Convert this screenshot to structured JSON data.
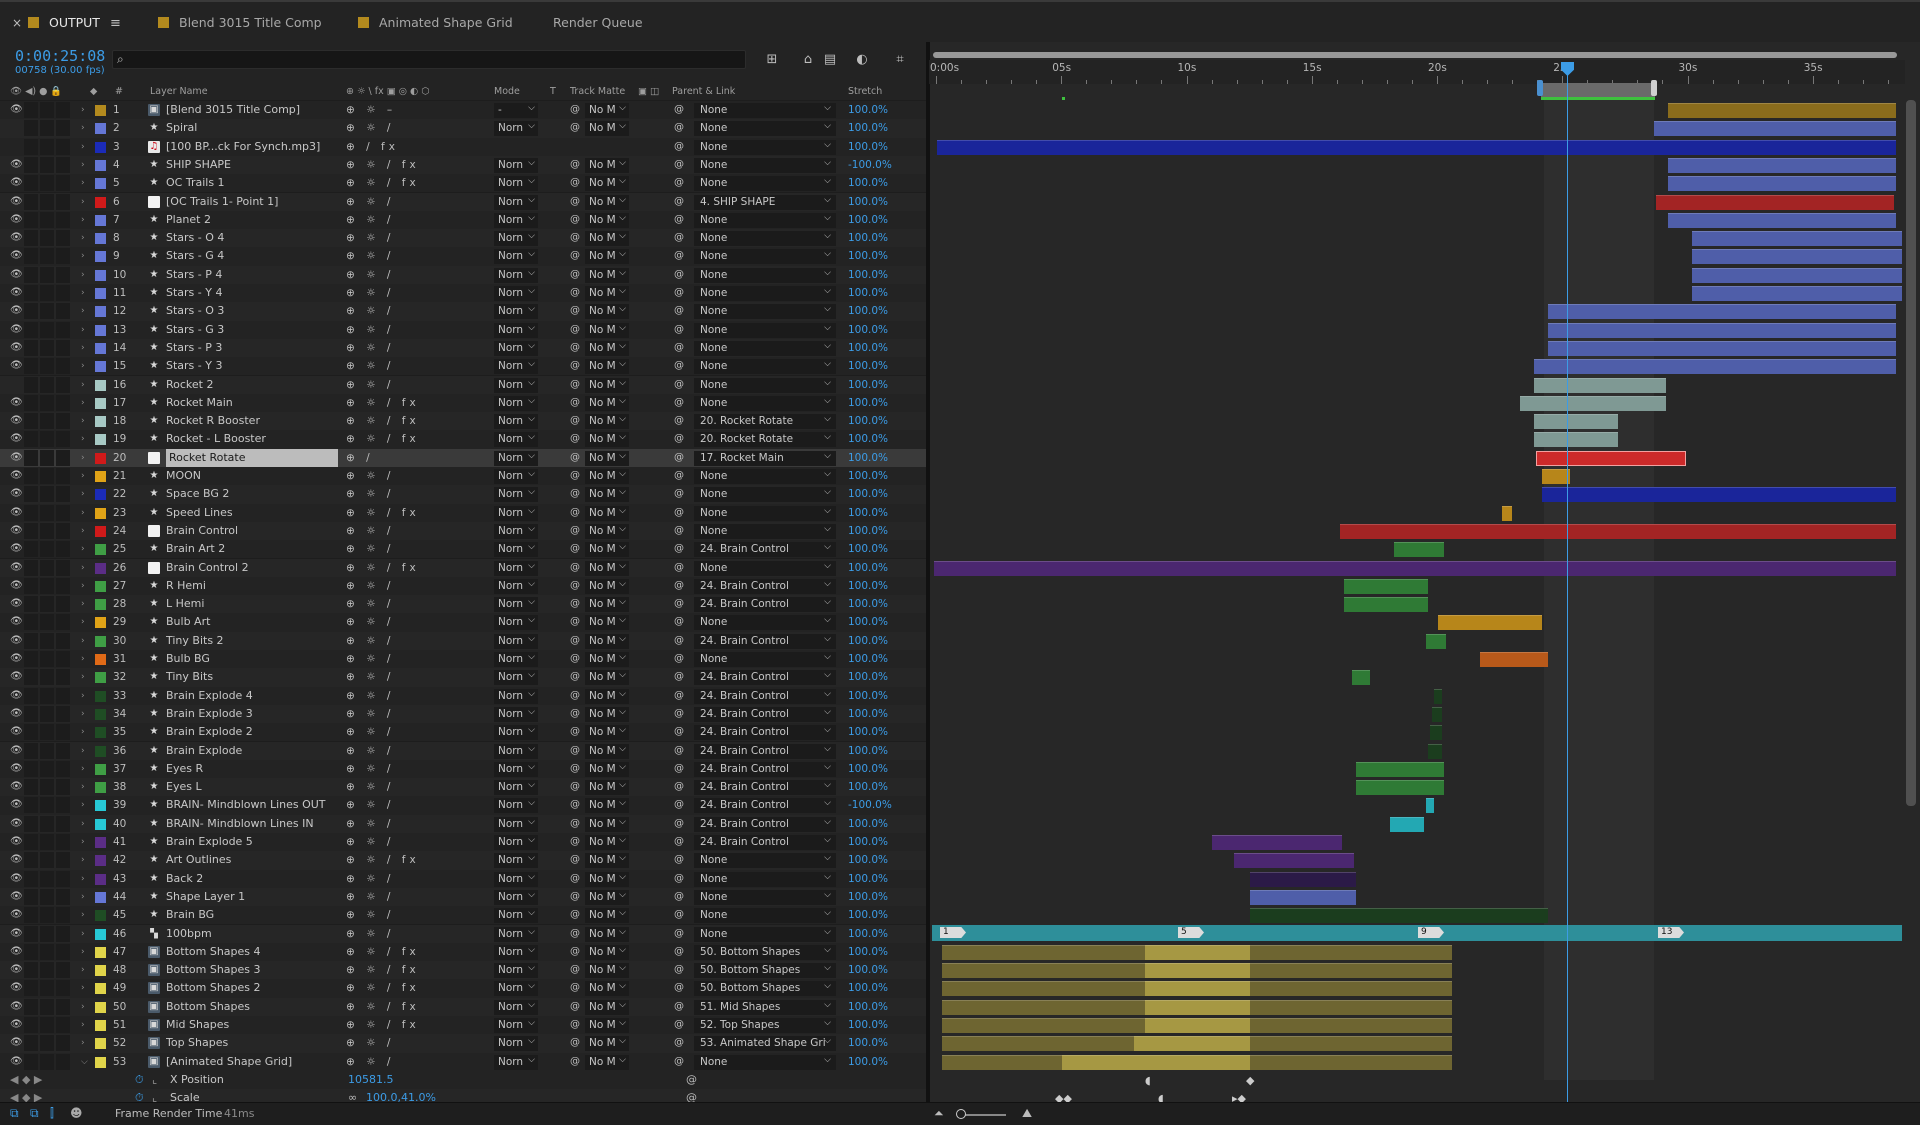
{
  "tabs": [
    {
      "label": "OUTPUT",
      "color": "#b38a1e",
      "active": true
    },
    {
      "label": "Blend 3015 Title Comp",
      "color": "#b38a1e"
    },
    {
      "label": "Animated Shape Grid",
      "color": "#b38a1e"
    },
    {
      "label": "Render Queue"
    }
  ],
  "header": {
    "timecode": "0:00:25:08",
    "frames": "00758 (30.00 fps)",
    "search_placeholder": ""
  },
  "columns": {
    "layer_name": "Layer Name",
    "mode": "Mode",
    "t": "T",
    "track_matte": "Track Matte",
    "parent": "Parent & Link",
    "stretch": "Stretch",
    "num": "#"
  },
  "ruler": {
    "labels": [
      "0:00s",
      "05s",
      "10s",
      "15s",
      "20s",
      "25s",
      "30s",
      "35s"
    ]
  },
  "layers": [
    {
      "n": "1",
      "name": "[Blend 3015 Title Comp]",
      "color": "#b38a1e",
      "icon": "comp",
      "sw": "⊕ ☼ –",
      "mode": "-",
      "matte": "No M",
      "parent": "None",
      "stretch": "100.0%",
      "eye": true
    },
    {
      "n": "2",
      "name": "Spiral",
      "color": "#6577d6",
      "icon": "shape",
      "sw": "⊕ ☼ /",
      "mode": "Norn",
      "matte": "No M",
      "parent": "None",
      "stretch": "100.0%",
      "eye": false
    },
    {
      "n": "3",
      "name": "[100 BP...ck For Synch.mp3]",
      "color": "#1b2bb8",
      "icon": "audio",
      "sw": "⊕   / fx",
      "mode": "",
      "matte": "",
      "parent": "None",
      "stretch": "100.0%",
      "eye": false
    },
    {
      "n": "4",
      "name": "SHIP SHAPE",
      "color": "#6577d6",
      "icon": "shape",
      "sw": "⊕ ☼ / fx",
      "mode": "Norn",
      "matte": "No M",
      "parent": "None",
      "stretch": "-100.0%",
      "eye": true
    },
    {
      "n": "5",
      "name": "OC Trails 1",
      "color": "#6577d6",
      "icon": "shape",
      "sw": "⊕ ☼ / fx",
      "mode": "Norn",
      "matte": "No M",
      "parent": "None",
      "stretch": "100.0%",
      "eye": true
    },
    {
      "n": "6",
      "name": "[OC Trails 1- Point 1]",
      "color": "#d01a1a",
      "icon": "null",
      "sw": "⊕ ☼ /",
      "mode": "Norn",
      "matte": "No M",
      "parent": "4. SHIP SHAPE",
      "stretch": "100.0%",
      "eye": true
    },
    {
      "n": "7",
      "name": "Planet 2",
      "color": "#6577d6",
      "icon": "shape",
      "sw": "⊕ ☼ /",
      "mode": "Norn",
      "matte": "No M",
      "parent": "None",
      "stretch": "100.0%",
      "eye": true
    },
    {
      "n": "8",
      "name": "Stars - O 4",
      "color": "#6577d6",
      "icon": "shape",
      "sw": "⊕ ☼ /",
      "mode": "Norn",
      "matte": "No M",
      "parent": "None",
      "stretch": "100.0%",
      "eye": true
    },
    {
      "n": "9",
      "name": "Stars - G 4",
      "color": "#6577d6",
      "icon": "shape",
      "sw": "⊕ ☼ /",
      "mode": "Norn",
      "matte": "No M",
      "parent": "None",
      "stretch": "100.0%",
      "eye": true
    },
    {
      "n": "10",
      "name": "Stars - P 4",
      "color": "#6577d6",
      "icon": "shape",
      "sw": "⊕ ☼ /",
      "mode": "Norn",
      "matte": "No M",
      "parent": "None",
      "stretch": "100.0%",
      "eye": true
    },
    {
      "n": "11",
      "name": "Stars - Y 4",
      "color": "#6577d6",
      "icon": "shape",
      "sw": "⊕ ☼ /",
      "mode": "Norn",
      "matte": "No M",
      "parent": "None",
      "stretch": "100.0%",
      "eye": true
    },
    {
      "n": "12",
      "name": "Stars - O 3",
      "color": "#6577d6",
      "icon": "shape",
      "sw": "⊕ ☼ /",
      "mode": "Norn",
      "matte": "No M",
      "parent": "None",
      "stretch": "100.0%",
      "eye": true
    },
    {
      "n": "13",
      "name": "Stars - G 3",
      "color": "#6577d6",
      "icon": "shape",
      "sw": "⊕ ☼ /",
      "mode": "Norn",
      "matte": "No M",
      "parent": "None",
      "stretch": "100.0%",
      "eye": true
    },
    {
      "n": "14",
      "name": "Stars - P 3",
      "color": "#6577d6",
      "icon": "shape",
      "sw": "⊕ ☼ /",
      "mode": "Norn",
      "matte": "No M",
      "parent": "None",
      "stretch": "100.0%",
      "eye": true
    },
    {
      "n": "15",
      "name": "Stars - Y 3",
      "color": "#6577d6",
      "icon": "shape",
      "sw": "⊕ ☼ /",
      "mode": "Norn",
      "matte": "No M",
      "parent": "None",
      "stretch": "100.0%",
      "eye": true
    },
    {
      "n": "16",
      "name": "Rocket 2",
      "color": "#a7c9c4",
      "icon": "shape",
      "sw": "⊕ ☼ /",
      "mode": "Norn",
      "matte": "No M",
      "parent": "None",
      "stretch": "100.0%",
      "eye": false
    },
    {
      "n": "17",
      "name": "Rocket Main",
      "color": "#a7c9c4",
      "icon": "shape",
      "sw": "⊕ ☼ / fx",
      "mode": "Norn",
      "matte": "No M",
      "parent": "None",
      "stretch": "100.0%",
      "eye": true
    },
    {
      "n": "18",
      "name": "Rocket R Booster",
      "color": "#a7c9c4",
      "icon": "shape",
      "sw": "⊕ ☼ / fx",
      "mode": "Norn",
      "matte": "No M",
      "parent": "20. Rocket Rotate",
      "stretch": "100.0%",
      "eye": true
    },
    {
      "n": "19",
      "name": "Rocket - L Booster",
      "color": "#a7c9c4",
      "icon": "shape",
      "sw": "⊕ ☼ / fx",
      "mode": "Norn",
      "matte": "No M",
      "parent": "20. Rocket Rotate",
      "stretch": "100.0%",
      "eye": true
    },
    {
      "n": "20",
      "name": "Rocket Rotate",
      "color": "#d01a1a",
      "icon": "null",
      "sw": "⊕   /",
      "mode": "Norn",
      "matte": "No M",
      "parent": "17. Rocket Main",
      "stretch": "100.0%",
      "eye": true,
      "sel": true
    },
    {
      "n": "21",
      "name": "MOON",
      "color": "#e0a317",
      "icon": "shape",
      "sw": "⊕ ☼ /",
      "mode": "Norn",
      "matte": "No M",
      "parent": "None",
      "stretch": "100.0%",
      "eye": true
    },
    {
      "n": "22",
      "name": "Space BG 2",
      "color": "#1b2bb8",
      "icon": "shape",
      "sw": "⊕ ☼ /",
      "mode": "Norn",
      "matte": "No M",
      "parent": "None",
      "stretch": "100.0%",
      "eye": true
    },
    {
      "n": "23",
      "name": "Speed Lines",
      "color": "#e0a317",
      "icon": "shape",
      "sw": "⊕ ☼ / fx",
      "mode": "Norn",
      "matte": "No M",
      "parent": "None",
      "stretch": "100.0%",
      "eye": true
    },
    {
      "n": "24",
      "name": "Brain Control",
      "color": "#d01a1a",
      "icon": "null",
      "sw": "⊕ ☼ /",
      "mode": "Norn",
      "matte": "No M",
      "parent": "None",
      "stretch": "100.0%",
      "eye": true
    },
    {
      "n": "25",
      "name": "Brain Art 2",
      "color": "#3f9e45",
      "icon": "shape",
      "sw": "⊕ ☼ /",
      "mode": "Norn",
      "matte": "No M",
      "parent": "24. Brain Control",
      "stretch": "100.0%",
      "eye": true
    },
    {
      "n": "26",
      "name": "Brain Control 2",
      "color": "#5b2d86",
      "icon": "null",
      "sw": "⊕ ☼ / fx",
      "mode": "Norn",
      "matte": "No M",
      "parent": "None",
      "stretch": "100.0%",
      "eye": true
    },
    {
      "n": "27",
      "name": "R Hemi",
      "color": "#3f9e45",
      "icon": "shape",
      "sw": "⊕ ☼ /",
      "mode": "Norn",
      "matte": "No M",
      "parent": "24. Brain Control",
      "stretch": "100.0%",
      "eye": true
    },
    {
      "n": "28",
      "name": "L Hemi",
      "color": "#3f9e45",
      "icon": "shape",
      "sw": "⊕ ☼ /",
      "mode": "Norn",
      "matte": "No M",
      "parent": "24. Brain Control",
      "stretch": "100.0%",
      "eye": true
    },
    {
      "n": "29",
      "name": "Bulb Art",
      "color": "#e0a317",
      "icon": "shape",
      "sw": "⊕ ☼ /",
      "mode": "Norn",
      "matte": "No M",
      "parent": "None",
      "stretch": "100.0%",
      "eye": true
    },
    {
      "n": "30",
      "name": "Tiny Bits 2",
      "color": "#3f9e45",
      "icon": "shape",
      "sw": "⊕ ☼ /",
      "mode": "Norn",
      "matte": "No M",
      "parent": "24. Brain Control",
      "stretch": "100.0%",
      "eye": true
    },
    {
      "n": "31",
      "name": "Bulb BG",
      "color": "#e06a17",
      "icon": "shape",
      "sw": "⊕ ☼ /",
      "mode": "Norn",
      "matte": "No M",
      "parent": "None",
      "stretch": "100.0%",
      "eye": true
    },
    {
      "n": "32",
      "name": "Tiny Bits",
      "color": "#3f9e45",
      "icon": "shape",
      "sw": "⊕ ☼ /",
      "mode": "Norn",
      "matte": "No M",
      "parent": "24. Brain Control",
      "stretch": "100.0%",
      "eye": true
    },
    {
      "n": "33",
      "name": "Brain Explode 4",
      "color": "#1f4d24",
      "icon": "shape",
      "sw": "⊕ ☼ /",
      "mode": "Norn",
      "matte": "No M",
      "parent": "24. Brain Control",
      "stretch": "100.0%",
      "eye": true
    },
    {
      "n": "34",
      "name": "Brain Explode 3",
      "color": "#1f4d24",
      "icon": "shape",
      "sw": "⊕ ☼ /",
      "mode": "Norn",
      "matte": "No M",
      "parent": "24. Brain Control",
      "stretch": "100.0%",
      "eye": true
    },
    {
      "n": "35",
      "name": "Brain Explode 2",
      "color": "#1f4d24",
      "icon": "shape",
      "sw": "⊕ ☼ /",
      "mode": "Norn",
      "matte": "No M",
      "parent": "24. Brain Control",
      "stretch": "100.0%",
      "eye": true
    },
    {
      "n": "36",
      "name": "Brain Explode",
      "color": "#1f4d24",
      "icon": "shape",
      "sw": "⊕ ☼ /",
      "mode": "Norn",
      "matte": "No M",
      "parent": "24. Brain Control",
      "stretch": "100.0%",
      "eye": true
    },
    {
      "n": "37",
      "name": "Eyes R",
      "color": "#3f9e45",
      "icon": "shape",
      "sw": "⊕ ☼ /",
      "mode": "Norn",
      "matte": "No M",
      "parent": "24. Brain Control",
      "stretch": "100.0%",
      "eye": true
    },
    {
      "n": "38",
      "name": "Eyes L",
      "color": "#3f9e45",
      "icon": "shape",
      "sw": "⊕ ☼ /",
      "mode": "Norn",
      "matte": "No M",
      "parent": "24. Brain Control",
      "stretch": "100.0%",
      "eye": true
    },
    {
      "n": "39",
      "name": "BRAIN- Mindblown Lines OUT",
      "color": "#27c9d6",
      "icon": "shape",
      "sw": "⊕ ☼ /",
      "mode": "Norn",
      "matte": "No M",
      "parent": "24. Brain Control",
      "stretch": "-100.0%",
      "eye": true
    },
    {
      "n": "40",
      "name": "BRAIN- Mindblown Lines IN",
      "color": "#27c9d6",
      "icon": "shape",
      "sw": "⊕ ☼ /",
      "mode": "Norn",
      "matte": "No M",
      "parent": "24. Brain Control",
      "stretch": "100.0%",
      "eye": true
    },
    {
      "n": "41",
      "name": "Brain Explode 5",
      "color": "#5b2d86",
      "icon": "shape",
      "sw": "⊕ ☼ /",
      "mode": "Norn",
      "matte": "No M",
      "parent": "24. Brain Control",
      "stretch": "100.0%",
      "eye": true
    },
    {
      "n": "42",
      "name": "Art Outlines",
      "color": "#5b2d86",
      "icon": "shape",
      "sw": "⊕ ☼ / fx",
      "mode": "Norn",
      "matte": "No M",
      "parent": "None",
      "stretch": "100.0%",
      "eye": true
    },
    {
      "n": "43",
      "name": "Back 2",
      "color": "#5b2d86",
      "icon": "shape",
      "sw": "⊕ ☼ /",
      "mode": "Norn",
      "matte": "No M",
      "parent": "None",
      "stretch": "100.0%",
      "eye": true
    },
    {
      "n": "44",
      "name": "Shape Layer 1",
      "color": "#6577d6",
      "icon": "shape",
      "sw": "⊕ ☼ /",
      "mode": "Norn",
      "matte": "No M",
      "parent": "None",
      "stretch": "100.0%",
      "eye": true
    },
    {
      "n": "45",
      "name": "Brain BG",
      "color": "#1f4d24",
      "icon": "shape",
      "sw": "⊕ ☼ /",
      "mode": "Norn",
      "matte": "No M",
      "parent": "None",
      "stretch": "100.0%",
      "eye": true
    },
    {
      "n": "46",
      "name": "100bpm",
      "color": "#27c9d6",
      "icon": "marker",
      "sw": "⊕ ☼ /",
      "mode": "Norn",
      "matte": "No M",
      "parent": "None",
      "stretch": "100.0%",
      "eye": true
    },
    {
      "n": "47",
      "name": "Bottom Shapes 4",
      "color": "#e0d44a",
      "icon": "comp",
      "sw": "⊕ ☼ / fx",
      "mode": "Norn",
      "matte": "No M",
      "parent": "50. Bottom Shapes",
      "stretch": "100.0%",
      "eye": true
    },
    {
      "n": "48",
      "name": "Bottom Shapes 3",
      "color": "#e0d44a",
      "icon": "comp",
      "sw": "⊕ ☼ / fx",
      "mode": "Norn",
      "matte": "No M",
      "parent": "50. Bottom Shapes",
      "stretch": "100.0%",
      "eye": true
    },
    {
      "n": "49",
      "name": "Bottom Shapes 2",
      "color": "#e0d44a",
      "icon": "comp",
      "sw": "⊕ ☼ / fx",
      "mode": "Norn",
      "matte": "No M",
      "parent": "50. Bottom Shapes",
      "stretch": "100.0%",
      "eye": true
    },
    {
      "n": "50",
      "name": "Bottom Shapes",
      "color": "#e0d44a",
      "icon": "comp",
      "sw": "⊕ ☼ / fx",
      "mode": "Norn",
      "matte": "No M",
      "parent": "51. Mid Shapes",
      "stretch": "100.0%",
      "eye": true
    },
    {
      "n": "51",
      "name": "Mid Shapes",
      "color": "#e0d44a",
      "icon": "comp",
      "sw": "⊕ ☼ / fx",
      "mode": "Norn",
      "matte": "No M",
      "parent": "52. Top Shapes",
      "stretch": "100.0%",
      "eye": true
    },
    {
      "n": "52",
      "name": "Top Shapes",
      "color": "#e0d44a",
      "icon": "comp",
      "sw": "⊕ ☼ /",
      "mode": "Norn",
      "matte": "No M",
      "parent": "53. Animated Shape Gri",
      "stretch": "100.0%",
      "eye": true
    },
    {
      "n": "53",
      "name": "[Animated Shape Grid]",
      "color": "#e0d44a",
      "icon": "comp",
      "sw": "⊕ ☼ /",
      "mode": "Norn",
      "matte": "No M",
      "parent": "None",
      "stretch": "100.0%",
      "eye": true
    }
  ],
  "properties": [
    {
      "name": "X Position",
      "value": "10581.5"
    },
    {
      "name": "Scale",
      "value": "100.0,41.0%"
    }
  ],
  "markers": [
    "1",
    "5",
    "9",
    "13"
  ],
  "footer": {
    "label": "Frame Render Time",
    "value": "41ms"
  }
}
